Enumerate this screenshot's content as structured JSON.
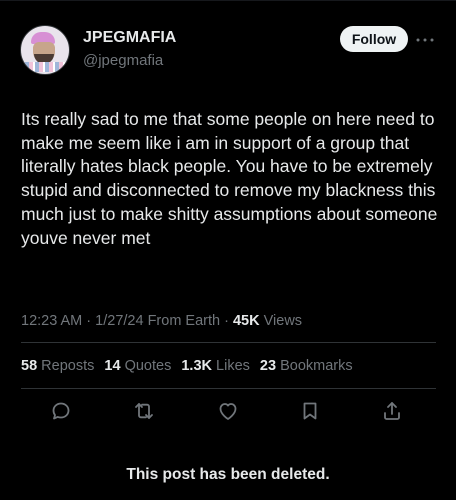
{
  "author": {
    "display_name": "JPEGMAFIA",
    "handle": "@jpegmafia"
  },
  "header": {
    "follow_label": "Follow",
    "more_icon": "more-dots-icon"
  },
  "tweet": {
    "text": "Its really sad to me that some people on here need to make me seem like i am in support of a group that literally hates black people. You have to be extremely stupid and disconnected to remove my blackness this much just to make shitty assumptions about someone youve never met"
  },
  "meta": {
    "time": "12:23 AM",
    "date": "1/27/24",
    "source": "From Earth",
    "views_count": "45K",
    "views_label": "Views"
  },
  "stats": [
    {
      "count": "58",
      "label": "Reposts"
    },
    {
      "count": "14",
      "label": "Quotes"
    },
    {
      "count": "1.3K",
      "label": "Likes"
    },
    {
      "count": "23",
      "label": "Bookmarks"
    }
  ],
  "actions": [
    "reply-icon",
    "repost-icon",
    "like-icon",
    "bookmark-icon",
    "share-icon"
  ],
  "banner": {
    "text": "This post has been deleted."
  },
  "colors": {
    "background": "#000000",
    "primary_text": "#e7e9ea",
    "secondary_text": "#71767b",
    "divider": "#2f3336",
    "follow_button_bg": "#eff3f4"
  }
}
